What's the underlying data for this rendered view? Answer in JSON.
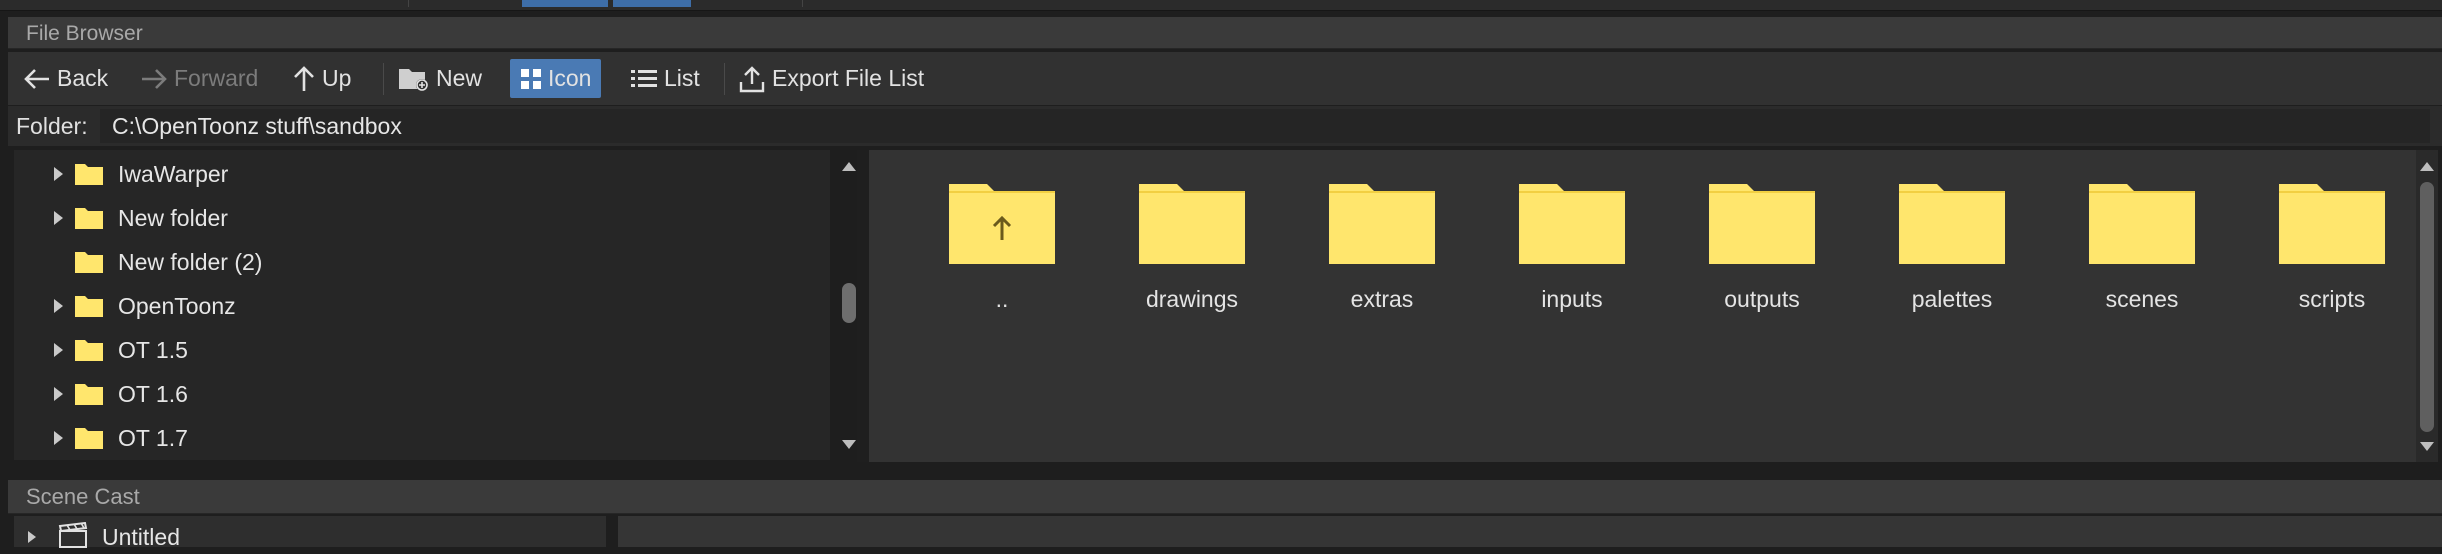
{
  "colors": {
    "accent": "#4a7ab4",
    "folder_fill": "#ffe66d",
    "folder_tab": "#f7d84a",
    "background": "#2f2f2f"
  },
  "file_browser": {
    "title": "File Browser",
    "toolbar": {
      "back_label": "Back",
      "forward_label": "Forward",
      "up_label": "Up",
      "new_label": "New",
      "icon_label": "Icon",
      "list_label": "List",
      "export_label": "Export File List"
    },
    "folder_label": "Folder:",
    "folder_path": "C:\\OpenToonz stuff\\sandbox",
    "tree": [
      {
        "label": "IwaWarper",
        "expandable": true
      },
      {
        "label": "New folder",
        "expandable": true
      },
      {
        "label": "New folder (2)",
        "expandable": false
      },
      {
        "label": "OpenToonz",
        "expandable": true
      },
      {
        "label": "OT 1.5",
        "expandable": true
      },
      {
        "label": "OT 1.6",
        "expandable": true
      },
      {
        "label": "OT 1.7",
        "expandable": true
      }
    ],
    "items": [
      {
        "name": "..",
        "icon": "parent-folder-icon"
      },
      {
        "name": "drawings",
        "icon": "folder-icon"
      },
      {
        "name": "extras",
        "icon": "folder-icon"
      },
      {
        "name": "inputs",
        "icon": "folder-icon"
      },
      {
        "name": "outputs",
        "icon": "folder-icon"
      },
      {
        "name": "palettes",
        "icon": "folder-icon"
      },
      {
        "name": "scenes",
        "icon": "folder-icon"
      },
      {
        "name": "scripts",
        "icon": "folder-icon"
      }
    ]
  },
  "scene_cast": {
    "title": "Scene Cast",
    "root_item": "Untitled"
  }
}
